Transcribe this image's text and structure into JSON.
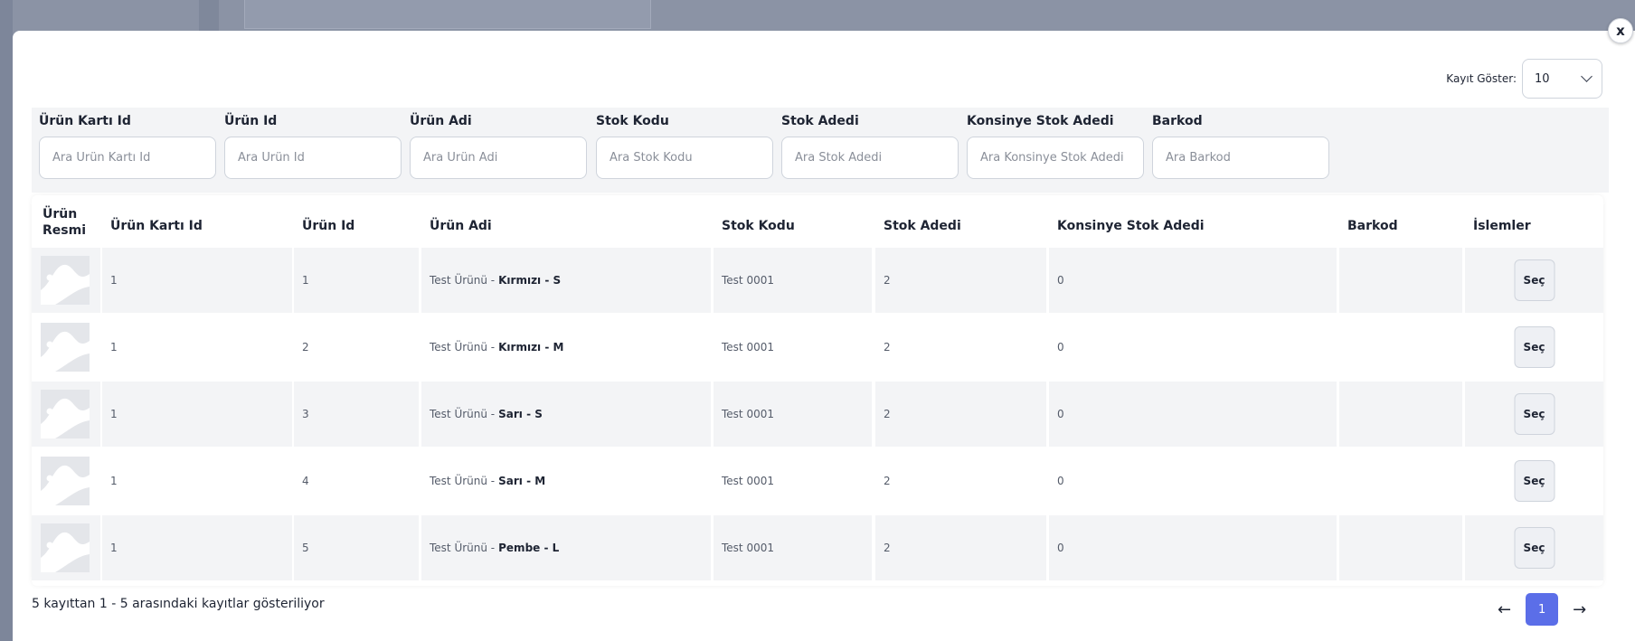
{
  "close_label": "x",
  "show": {
    "label": "Kayıt Göster:",
    "selected": "10"
  },
  "filters": [
    {
      "label": "Ürün Kartı Id",
      "placeholder": "Ara Ürün Kartı Id"
    },
    {
      "label": "Ürün Id",
      "placeholder": "Ara Ürün Id"
    },
    {
      "label": "Ürün Adi",
      "placeholder": "Ara Ürün Adi"
    },
    {
      "label": "Stok Kodu",
      "placeholder": "Ara Stok Kodu"
    },
    {
      "label": "Stok Adedi",
      "placeholder": "Ara Stok Adedi"
    },
    {
      "label": "Konsinye Stok Adedi",
      "placeholder": "Ara Konsinye Stok Adedi"
    },
    {
      "label": "Barkod",
      "placeholder": "Ara Barkod"
    }
  ],
  "table": {
    "headers": {
      "image_line1": "Ürün",
      "image_line2": "Resmi",
      "card_id": "Ürün Kartı Id",
      "product_id": "Ürün Id",
      "name": "Ürün Adi",
      "stock_code": "Stok Kodu",
      "stock_qty": "Stok Adedi",
      "consign_qty": "Konsinye Stok Adedi",
      "barcode": "Barkod",
      "actions": "İslemler"
    },
    "rows": [
      {
        "card_id": "1",
        "product_id": "1",
        "name_prefix": "Test Ürünü -",
        "variant": "Kırmızı - S",
        "stock_code": "Test 0001",
        "stock_qty": "2",
        "consign_qty": "0",
        "barcode": "",
        "action": "Seç"
      },
      {
        "card_id": "1",
        "product_id": "2",
        "name_prefix": "Test Ürünü -",
        "variant": "Kırmızı - M",
        "stock_code": "Test 0001",
        "stock_qty": "2",
        "consign_qty": "0",
        "barcode": "",
        "action": "Seç"
      },
      {
        "card_id": "1",
        "product_id": "3",
        "name_prefix": "Test Ürünü -",
        "variant": "Sarı - S",
        "stock_code": "Test 0001",
        "stock_qty": "2",
        "consign_qty": "0",
        "barcode": "",
        "action": "Seç"
      },
      {
        "card_id": "1",
        "product_id": "4",
        "name_prefix": "Test Ürünü -",
        "variant": "Sarı - M",
        "stock_code": "Test 0001",
        "stock_qty": "2",
        "consign_qty": "0",
        "barcode": "",
        "action": "Seç"
      },
      {
        "card_id": "1",
        "product_id": "5",
        "name_prefix": "Test Ürünü -",
        "variant": "Pembe - L",
        "stock_code": "Test 0001",
        "stock_qty": "2",
        "consign_qty": "0",
        "barcode": "",
        "action": "Seç"
      }
    ]
  },
  "summary": "5 kayıttan 1 - 5 arasındaki kayıtlar gösteriliyor",
  "pager": {
    "prev": "←",
    "current": "1",
    "next": "→"
  },
  "colors": {
    "accent": "#5b6ee8",
    "row_stripe": "#f3f4f6",
    "overlay": "#8a93a6"
  }
}
